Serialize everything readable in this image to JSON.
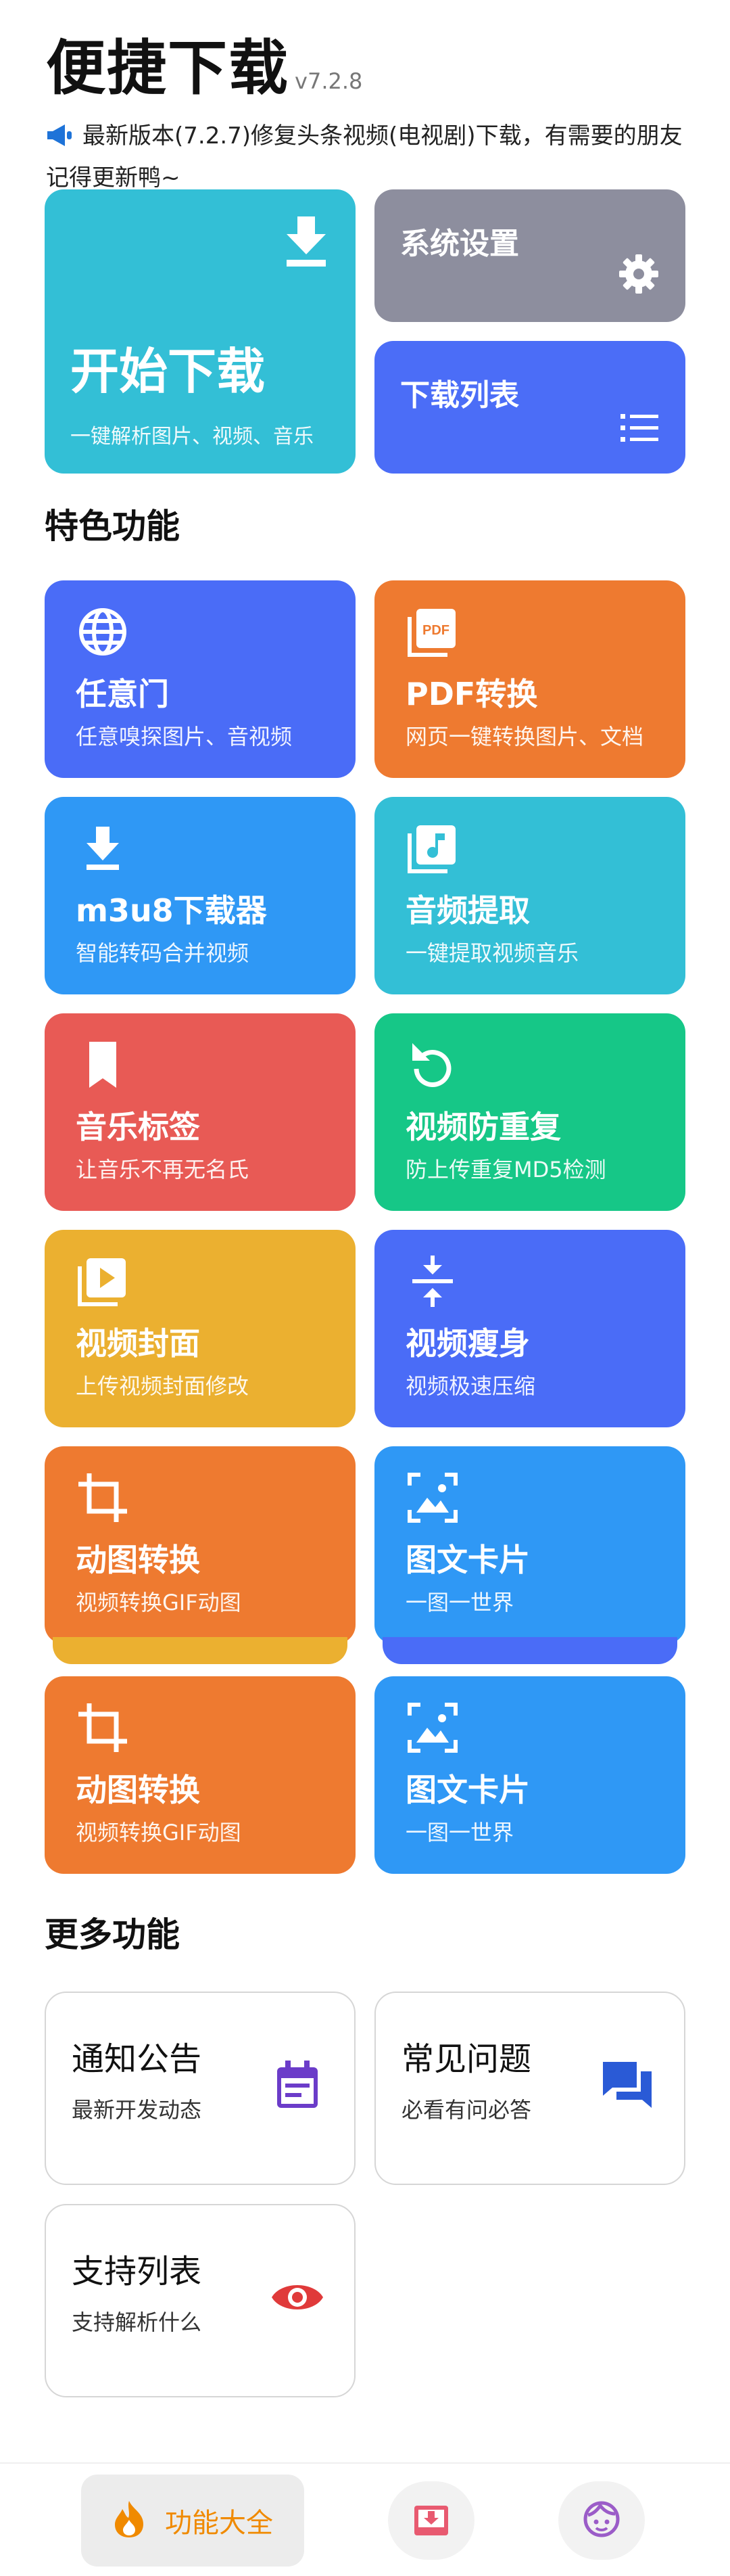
{
  "header": {
    "title": "便捷下载",
    "version": "v7.2.8",
    "notice": "最新版本(7.2.7)修复头条视频(电视剧)下载，有需要的朋友记得更新鸭~"
  },
  "hero": {
    "start": {
      "title": "开始下载",
      "subtitle": "一键解析图片、视频、音乐"
    },
    "settings": {
      "title": "系统设置"
    },
    "download_list": {
      "title": "下载列表"
    }
  },
  "sections": {
    "featured": "特色功能",
    "more": "更多功能"
  },
  "features": [
    {
      "title": "任意门",
      "subtitle": "任意嗅探图片、音视频",
      "icon": "globe-icon",
      "color": "#4a6cf7"
    },
    {
      "title": "PDF转换",
      "subtitle": "网页一键转换图片、文档",
      "icon": "pdf-icon",
      "color": "#ee7a30"
    },
    {
      "title": "m3u8下载器",
      "subtitle": "智能转码合并视频",
      "icon": "download-icon",
      "color": "#2f98f5"
    },
    {
      "title": "音频提取",
      "subtitle": "一键提取视频音乐",
      "icon": "music-file-icon",
      "color": "#33bfd6"
    },
    {
      "title": "音乐标签",
      "subtitle": "让音乐不再无名氏",
      "icon": "bookmark-icon",
      "color": "#e85a55"
    },
    {
      "title": "视频防重复",
      "subtitle": "防上传重复MD5检测",
      "icon": "refresh-icon",
      "color": "#16c787"
    },
    {
      "title": "视频封面",
      "subtitle": "上传视频封面修改",
      "icon": "video-cover-icon",
      "color": "#ebb030"
    },
    {
      "title": "视频瘦身",
      "subtitle": "视频极速压缩",
      "icon": "compress-icon",
      "color": "#4a6cf7"
    },
    {
      "title": "动图转换",
      "subtitle": "视频转换GIF动图",
      "icon": "crop-icon",
      "color": "#ee7a30"
    },
    {
      "title": "图文卡片",
      "subtitle": "一图一世界",
      "icon": "image-icon",
      "color": "#2f98f5"
    },
    {
      "title": "动图转换",
      "subtitle": "视频转换GIF动图",
      "icon": "crop-icon",
      "color": "#ee7a30"
    },
    {
      "title": "图文卡片",
      "subtitle": "一图一世界",
      "icon": "image-icon",
      "color": "#2f98f5"
    }
  ],
  "more": [
    {
      "title": "通知公告",
      "subtitle": "最新开发动态",
      "icon": "calendar-icon",
      "color": "#6b3cc9"
    },
    {
      "title": "常见问题",
      "subtitle": "必看有问必答",
      "icon": "chat-icon",
      "color": "#2a5ad6"
    },
    {
      "title": "支持列表",
      "subtitle": "支持解析什么",
      "icon": "eye-icon",
      "color": "#e03a3a"
    }
  ],
  "bottom_nav": {
    "active_label": "功能大全",
    "tabs": [
      "fire-icon",
      "download-box-icon",
      "face-icon"
    ],
    "accent": "#f08a00"
  }
}
